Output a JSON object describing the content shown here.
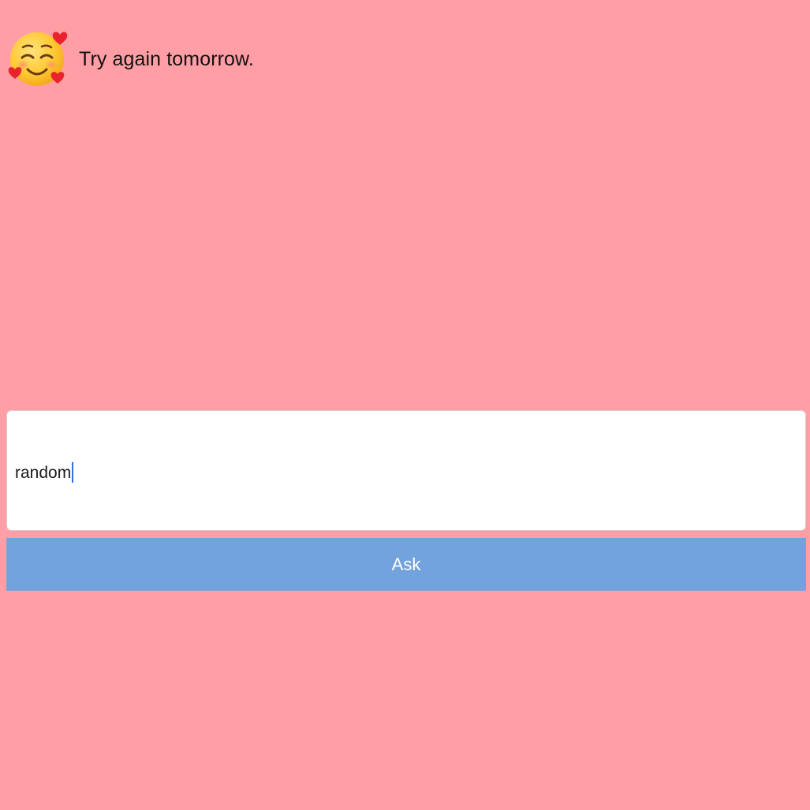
{
  "response": {
    "icon": "smiling-face-with-hearts-icon",
    "text": "Try again tomorrow."
  },
  "query": {
    "value": "random"
  },
  "ask_button": {
    "label": "Ask",
    "color": "#73a3dc"
  },
  "colors": {
    "background": "#ff9ea4",
    "input_background": "#ffffff",
    "caret": "#2f6fdc"
  }
}
